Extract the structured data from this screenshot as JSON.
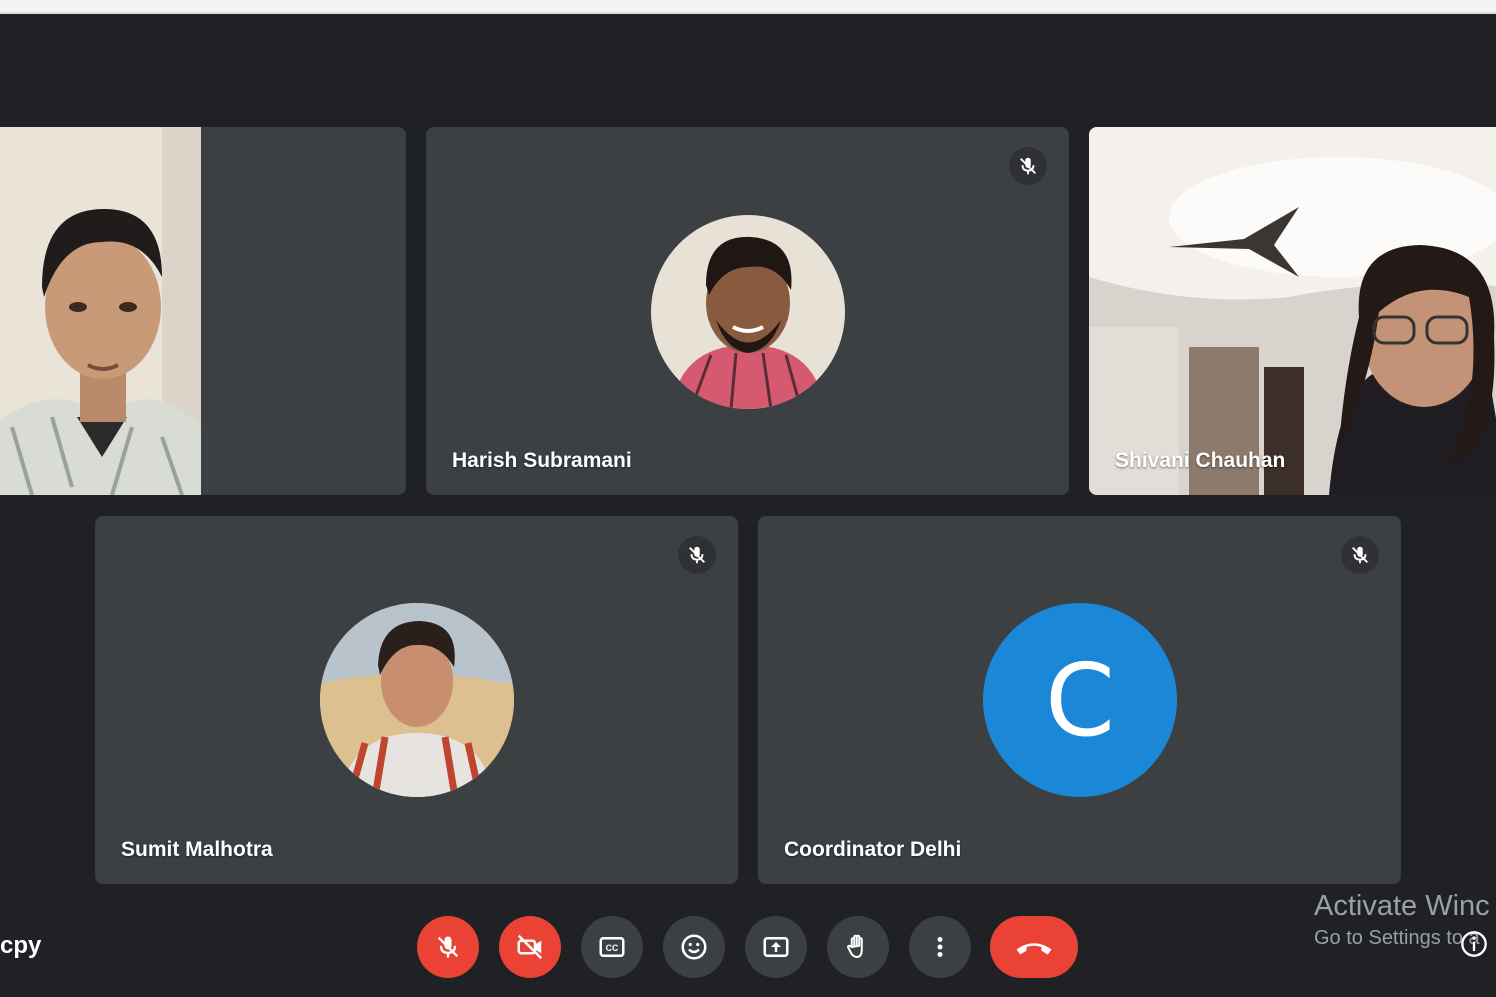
{
  "participants": {
    "tile1": {
      "name": ""
    },
    "tile2": {
      "name": "Harish Subramani"
    },
    "tile3": {
      "name": "Shivani Chauhan"
    },
    "tile4": {
      "name": "Sumit Malhotra"
    },
    "tile5": {
      "name": "Coordinator Delhi",
      "avatar_letter": "C"
    }
  },
  "bottom_left": {
    "text": "cpy"
  },
  "watermark": {
    "line1": "Activate Winc",
    "line2": "Go to Settings to a"
  },
  "colors": {
    "background": "#202124",
    "tile": "#3c4043",
    "danger": "#ea4335",
    "avatar_blue": "#1a88d6",
    "active_border": "#6aa4f5"
  },
  "controls": [
    {
      "name": "mic-off-button",
      "icon": "mic-off-icon"
    },
    {
      "name": "camera-off-button",
      "icon": "camera-off-icon"
    },
    {
      "name": "captions-button",
      "icon": "closed-captions-icon"
    },
    {
      "name": "emoji-button",
      "icon": "smiley-icon"
    },
    {
      "name": "present-button",
      "icon": "present-screen-icon"
    },
    {
      "name": "raise-hand-button",
      "icon": "hand-icon"
    },
    {
      "name": "more-options-button",
      "icon": "more-vertical-icon"
    },
    {
      "name": "leave-call-button",
      "icon": "phone-hangup-icon"
    }
  ]
}
